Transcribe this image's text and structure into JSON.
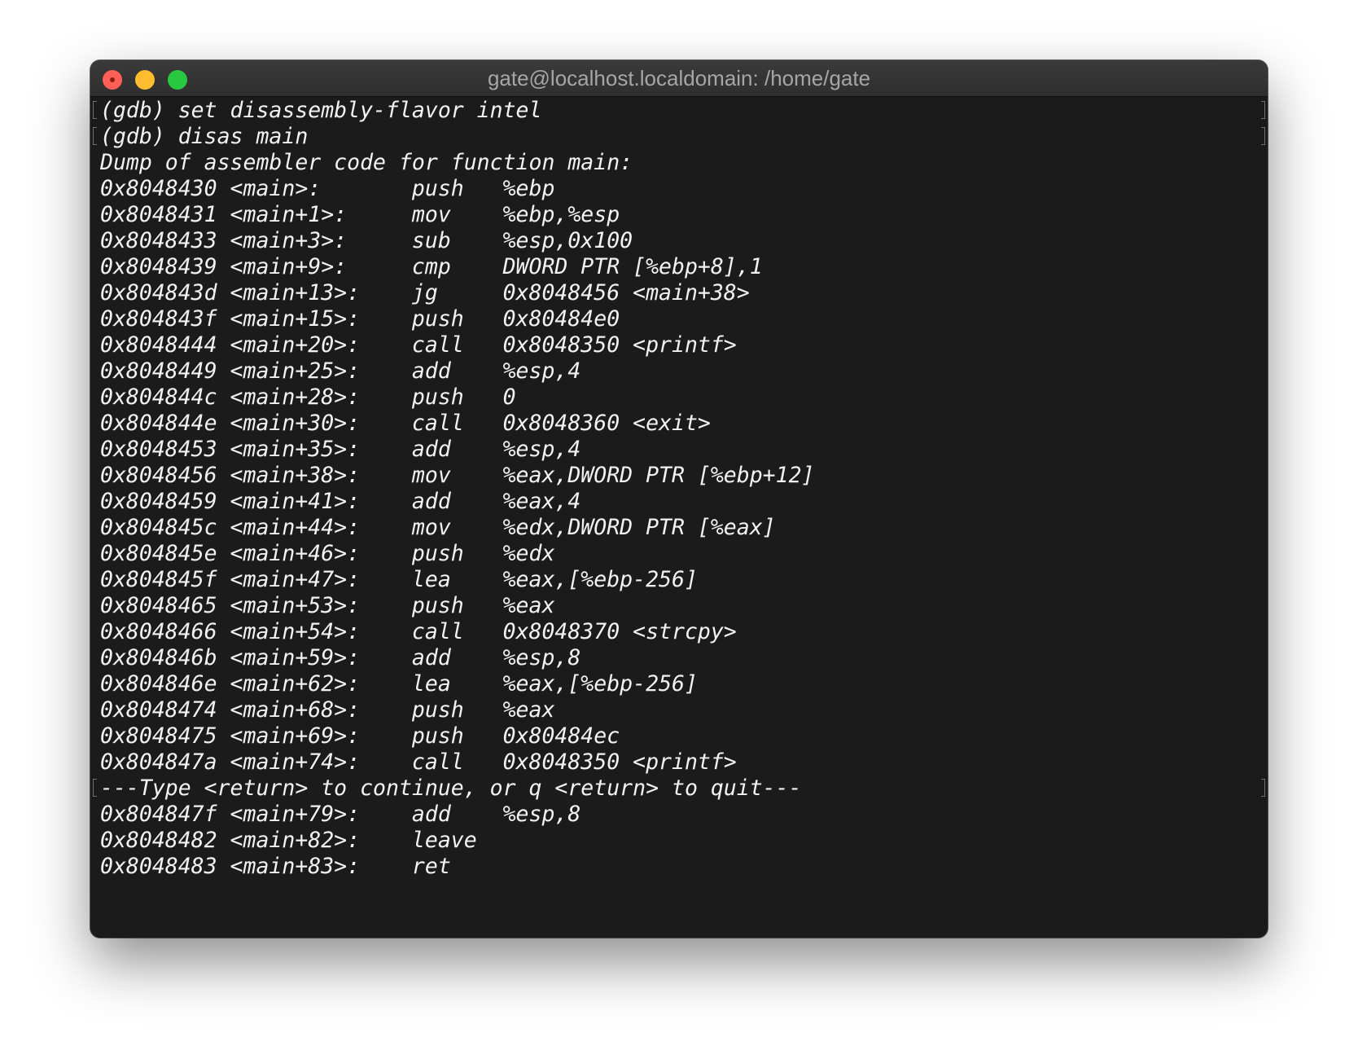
{
  "window": {
    "title": "gate@localhost.localdomain: /home/gate"
  },
  "terminal": {
    "lines": [
      "(gdb) set disassembly-flavor intel",
      "(gdb) disas main",
      "Dump of assembler code for function main:",
      "0x8048430 <main>:       push   %ebp",
      "0x8048431 <main+1>:     mov    %ebp,%esp",
      "0x8048433 <main+3>:     sub    %esp,0x100",
      "0x8048439 <main+9>:     cmp    DWORD PTR [%ebp+8],1",
      "0x804843d <main+13>:    jg     0x8048456 <main+38>",
      "0x804843f <main+15>:    push   0x80484e0",
      "0x8048444 <main+20>:    call   0x8048350 <printf>",
      "0x8048449 <main+25>:    add    %esp,4",
      "0x804844c <main+28>:    push   0",
      "0x804844e <main+30>:    call   0x8048360 <exit>",
      "0x8048453 <main+35>:    add    %esp,4",
      "0x8048456 <main+38>:    mov    %eax,DWORD PTR [%ebp+12]",
      "0x8048459 <main+41>:    add    %eax,4",
      "0x804845c <main+44>:    mov    %edx,DWORD PTR [%eax]",
      "0x804845e <main+46>:    push   %edx",
      "0x804845f <main+47>:    lea    %eax,[%ebp-256]",
      "0x8048465 <main+53>:    push   %eax",
      "0x8048466 <main+54>:    call   0x8048370 <strcpy>",
      "0x804846b <main+59>:    add    %esp,8",
      "0x804846e <main+62>:    lea    %eax,[%ebp-256]",
      "0x8048474 <main+68>:    push   %eax",
      "0x8048475 <main+69>:    push   0x80484ec",
      "0x804847a <main+74>:    call   0x8048350 <printf>",
      "---Type <return> to continue, or q <return> to quit---",
      "0x804847f <main+79>:    add    %esp,8",
      "0x8048482 <main+82>:    leave",
      "0x8048483 <main+83>:    ret"
    ]
  }
}
